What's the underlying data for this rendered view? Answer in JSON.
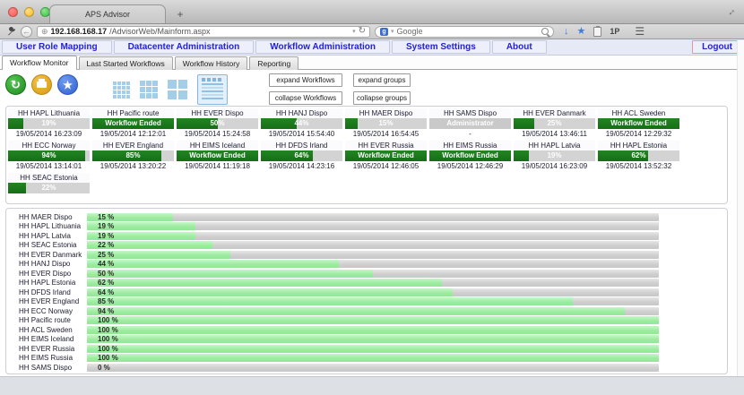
{
  "browser": {
    "tab_title": "APS Advisor",
    "new_tab_label": "+",
    "url_host": "192.168.168.17",
    "url_path": "/AdvisorWeb/Mainform.aspx",
    "search_placeholder": "Google",
    "onepassword_label": "1P"
  },
  "icons": {
    "back": "←",
    "globe": "⊕",
    "dropdown": "▾",
    "reload": "↻",
    "download": "↓",
    "star": "★",
    "hamburger": "☰",
    "fullscreen": "↔",
    "refresh_glyph": "↻",
    "favorite_glyph": "★",
    "google_favicon_letter": "g"
  },
  "menu": {
    "items": [
      "User Role Mapping",
      "Datacenter Administration",
      "Workflow Administration",
      "System Settings",
      "About"
    ],
    "logout_label": "Logout"
  },
  "app_tabs": {
    "items": [
      "Workflow Monitor",
      "Last Started Workflows",
      "Workflow History",
      "Reporting"
    ],
    "active_index": 0
  },
  "toolbar": {
    "buttons": [
      "expand Workflows",
      "expand groups",
      "collapse Workflows",
      "collapse groups"
    ]
  },
  "colors": {
    "progress_green_dark": "#1d7d1d",
    "progress_track_gray": "#d3d3d3",
    "chart_green_light": "#9cec9f",
    "menu_text_blue": "#2323cf",
    "logout_border_red": "#dd9a9a"
  },
  "cards": [
    {
      "name": "HH HAPL Lithuania",
      "status_label": "19%",
      "percent": 19,
      "timestamp": "19/05/2014 16:23:09",
      "variant": "progress"
    },
    {
      "name": "HH Pacific route",
      "status_label": "Workflow Ended",
      "percent": 100,
      "timestamp": "19/05/2014 12:12:01",
      "variant": "ended"
    },
    {
      "name": "HH EVER Dispo",
      "status_label": "50%",
      "percent": 50,
      "timestamp": "19/05/2014 15:24:58",
      "variant": "progress"
    },
    {
      "name": "HH HANJ Dispo",
      "status_label": "44%",
      "percent": 44,
      "timestamp": "19/05/2014 15:54:40",
      "variant": "progress"
    },
    {
      "name": "HH MAER Dispo",
      "status_label": "15%",
      "percent": 15,
      "timestamp": "19/05/2014 16:54:45",
      "variant": "progress"
    },
    {
      "name": "HH SAMS Dispo",
      "status_label": "Administrator",
      "percent": 0,
      "timestamp": "-",
      "variant": "admin"
    },
    {
      "name": "HH EVER Danmark",
      "status_label": "25%",
      "percent": 25,
      "timestamp": "19/05/2014 13:46:11",
      "variant": "progress"
    },
    {
      "name": "HH ACL Sweden",
      "status_label": "Workflow Ended",
      "percent": 100,
      "timestamp": "19/05/2014 12:29:32",
      "variant": "ended"
    },
    {
      "name": "HH ECC Norway",
      "status_label": "94%",
      "percent": 94,
      "timestamp": "19/05/2014 13:14:01",
      "variant": "progress"
    },
    {
      "name": "HH EVER England",
      "status_label": "85%",
      "percent": 85,
      "timestamp": "19/05/2014 13:20:22",
      "variant": "progress"
    },
    {
      "name": "HH EIMS Iceland",
      "status_label": "Workflow Ended",
      "percent": 100,
      "timestamp": "19/05/2014 11:19:18",
      "variant": "ended"
    },
    {
      "name": "HH DFDS Irland",
      "status_label": "64%",
      "percent": 64,
      "timestamp": "19/05/2014 14:23:16",
      "variant": "progress"
    },
    {
      "name": "HH EVER Russia",
      "status_label": "Workflow Ended",
      "percent": 100,
      "timestamp": "19/05/2014 12:46:05",
      "variant": "ended"
    },
    {
      "name": "HH EIMS Russia",
      "status_label": "Workflow Ended",
      "percent": 100,
      "timestamp": "19/05/2014 12:46:29",
      "variant": "ended"
    },
    {
      "name": "HH HAPL Latvia",
      "status_label": "19%",
      "percent": 19,
      "timestamp": "19/05/2014 16:23:09",
      "variant": "progress"
    },
    {
      "name": "HH HAPL Estonia",
      "status_label": "62%",
      "percent": 62,
      "timestamp": "19/05/2014 13:52:32",
      "variant": "progress"
    },
    {
      "name": "HH SEAC Estonia",
      "status_label": "22%",
      "percent": 22,
      "timestamp": "",
      "variant": "progress"
    }
  ],
  "progress_chart": {
    "type": "bar",
    "orientation": "horizontal",
    "value_range": [
      0,
      100
    ],
    "rows": [
      {
        "name": "HH MAER Dispo",
        "percent": 15,
        "label": "15 %"
      },
      {
        "name": "HH HAPL Lithuania",
        "percent": 19,
        "label": "19 %"
      },
      {
        "name": "HH HAPL Latvia",
        "percent": 19,
        "label": "19 %"
      },
      {
        "name": "HH SEAC Estonia",
        "percent": 22,
        "label": "22 %"
      },
      {
        "name": "HH EVER Danmark",
        "percent": 25,
        "label": "25 %"
      },
      {
        "name": "HH HANJ Dispo",
        "percent": 44,
        "label": "44 %"
      },
      {
        "name": "HH EVER Dispo",
        "percent": 50,
        "label": "50 %"
      },
      {
        "name": "HH HAPL Estonia",
        "percent": 62,
        "label": "62 %"
      },
      {
        "name": "HH DFDS Irland",
        "percent": 64,
        "label": "64 %"
      },
      {
        "name": "HH EVER England",
        "percent": 85,
        "label": "85 %"
      },
      {
        "name": "HH ECC Norway",
        "percent": 94,
        "label": "94 %"
      },
      {
        "name": "HH Pacific route",
        "percent": 100,
        "label": "100 %"
      },
      {
        "name": "HH ACL Sweden",
        "percent": 100,
        "label": "100 %"
      },
      {
        "name": "HH EIMS Iceland",
        "percent": 100,
        "label": "100 %"
      },
      {
        "name": "HH EVER Russia",
        "percent": 100,
        "label": "100 %"
      },
      {
        "name": "HH EIMS Russia",
        "percent": 100,
        "label": "100 %"
      },
      {
        "name": "HH SAMS Dispo",
        "percent": 0,
        "label": "0 %"
      }
    ]
  }
}
